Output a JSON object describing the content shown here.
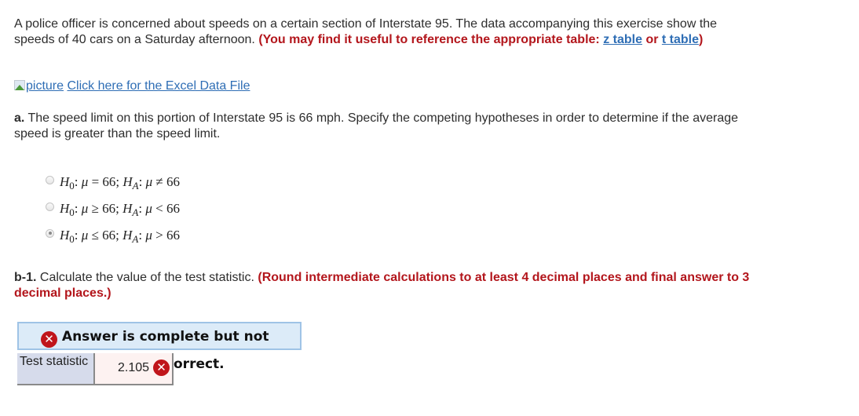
{
  "intro": {
    "text": "A police officer is concerned about speeds on a certain section of Interstate 95. The data accompanying this exercise show the speeds of 40 cars on a Saturday afternoon. ",
    "note_prefix": "(You may find it useful to reference the appropriate table: ",
    "z_link": "z table",
    "or_text": " or ",
    "t_link": "t table",
    "note_suffix": ")"
  },
  "data_file": {
    "image_alt": "picture",
    "link_label": "Click here for the Excel Data File"
  },
  "part_a": {
    "label": "a.",
    "text": " The speed limit on this portion of Interstate 95 is 66 mph. Specify the competing hypotheses in order to determine if the average speed is greater than the speed limit.",
    "options": [
      {
        "h0_op": "=",
        "value0": "66",
        "ha_op": "≠",
        "value_a": "66",
        "selected": false
      },
      {
        "h0_op": "≥",
        "value0": "66",
        "ha_op": "<",
        "value_a": "66",
        "selected": false
      },
      {
        "h0_op": "≤",
        "value0": "66",
        "ha_op": ">",
        "value_a": "66",
        "selected": true
      }
    ],
    "h0_symbol": "H",
    "h0_sub": "0",
    "ha_symbol": "H",
    "ha_sub": "A",
    "mu": "μ"
  },
  "part_b1": {
    "label": "b-1.",
    "text": " Calculate the value of the test statistic. ",
    "note": "(Round intermediate calculations to at least 4 decimal places and final answer to 3 decimal places.)"
  },
  "result": {
    "banner_line1": "Answer is complete but not",
    "banner_line2": "orrect.",
    "x_glyph": "✕",
    "row_label": "Test statistic",
    "row_value": "2.105",
    "status": "incorrect"
  },
  "colors": {
    "link": "#2f6eb5",
    "emphasis_red": "#b3161c",
    "banner_bg": "#dcebf8",
    "label_cell_bg": "#d6dbeb",
    "value_cell_bg": "#fdf2f1",
    "error_icon": "#c0151b"
  }
}
